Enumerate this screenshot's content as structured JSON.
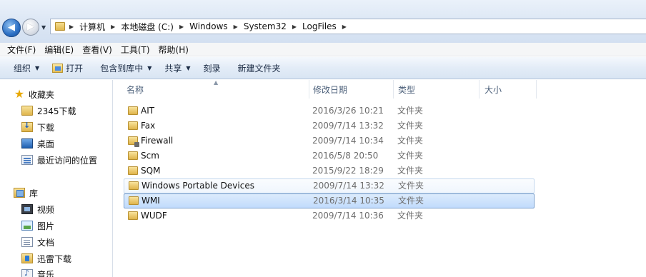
{
  "address": {
    "crumbs": [
      "计算机",
      "本地磁盘 (C:)",
      "Windows",
      "System32",
      "LogFiles"
    ]
  },
  "menu": [
    "文件(F)",
    "编辑(E)",
    "查看(V)",
    "工具(T)",
    "帮助(H)"
  ],
  "commands": {
    "organize": "组织",
    "open": "打开",
    "include_in_library": "包含到库中",
    "share": "共享",
    "burn": "刻录",
    "new_folder": "新建文件夹"
  },
  "nav": {
    "favorites": {
      "label": "收藏夹",
      "items": [
        "2345下载",
        "下载",
        "桌面",
        "最近访问的位置"
      ]
    },
    "libraries": {
      "label": "库",
      "items": [
        "视频",
        "图片",
        "文档",
        "迅雷下载",
        "音乐"
      ]
    }
  },
  "columns": {
    "name": "名称",
    "date": "修改日期",
    "type": "类型",
    "size": "大小"
  },
  "files": [
    {
      "name": "AIT",
      "date": "2016/3/26 10:21",
      "type": "文件夹",
      "state": "normal"
    },
    {
      "name": "Fax",
      "date": "2009/7/14 13:32",
      "type": "文件夹",
      "state": "normal"
    },
    {
      "name": "Firewall",
      "date": "2009/7/14 10:34",
      "type": "文件夹",
      "state": "locked"
    },
    {
      "name": "Scm",
      "date": "2016/5/8 20:50",
      "type": "文件夹",
      "state": "normal"
    },
    {
      "name": "SQM",
      "date": "2015/9/22 18:29",
      "type": "文件夹",
      "state": "normal"
    },
    {
      "name": "Windows Portable Devices",
      "date": "2009/7/14 13:32",
      "type": "文件夹",
      "state": "hover"
    },
    {
      "name": "WMI",
      "date": "2016/3/14 10:35",
      "type": "文件夹",
      "state": "selected"
    },
    {
      "name": "WUDF",
      "date": "2009/7/14 10:36",
      "type": "文件夹",
      "state": "normal"
    }
  ]
}
